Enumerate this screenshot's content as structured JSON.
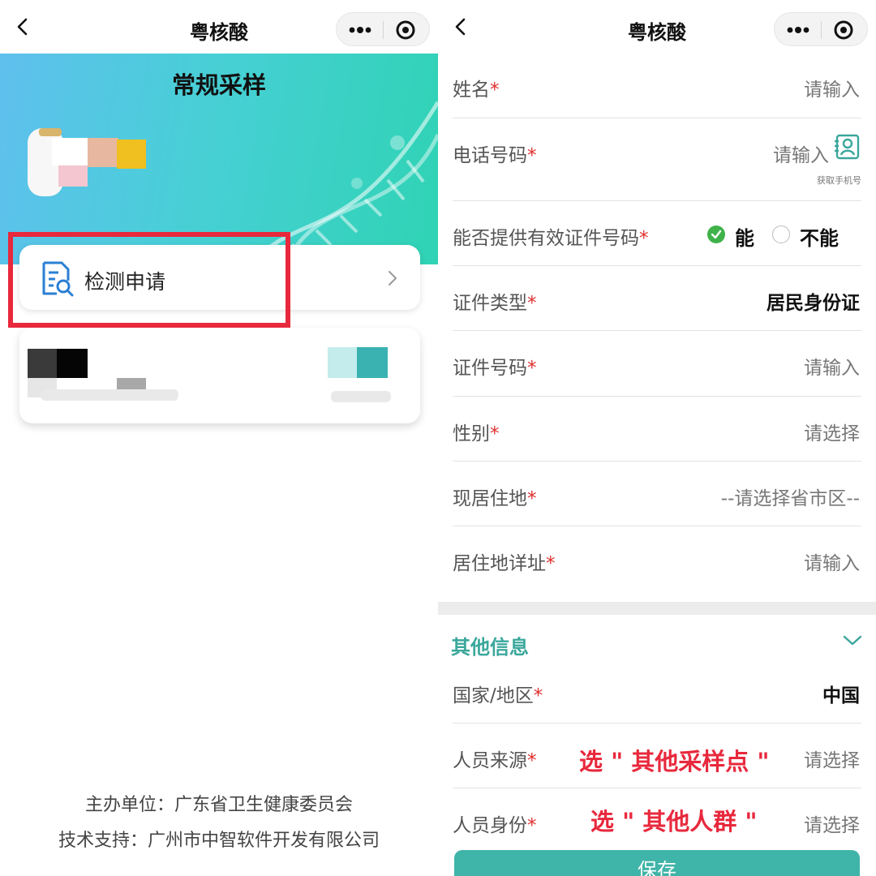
{
  "left": {
    "nav_title": "粤核酸",
    "hero_title": "常规采样",
    "apply_label": "检测申请",
    "footer_organizer": "主办单位：广东省卫生健康委员会",
    "footer_support": "技术支持：广州市中智软件开发有限公司",
    "colors": {
      "hero_start": "#5fc0ee",
      "hero_end": "#2fd3b4",
      "highlight": "#e8283c"
    }
  },
  "right": {
    "nav_title": "粤核酸",
    "fields": [
      {
        "label": "姓名",
        "required": "*",
        "value": "请输入"
      },
      {
        "label": "电话号码",
        "required": "*",
        "value": "请输入",
        "hint": "获取手机号"
      },
      {
        "label": "能否提供有效证件号码",
        "required": "*",
        "options": [
          "能",
          "不能"
        ],
        "selected": "能"
      },
      {
        "label": "证件类型",
        "required": "*",
        "value": "居民身份证"
      },
      {
        "label": "证件号码",
        "required": "*",
        "value": "请输入"
      },
      {
        "label": "性别",
        "required": "*",
        "value": "请选择"
      },
      {
        "label": "现居住地",
        "required": "*",
        "value": "--请选择省市区--"
      },
      {
        "label": "居住地详址",
        "required": "*",
        "value": "请输入"
      }
    ],
    "section_title": "其他信息",
    "other_fields": [
      {
        "label": "国家/地区",
        "required": "*",
        "value": "中国"
      },
      {
        "label": "人员来源",
        "required": "*",
        "value": "请选择",
        "annotation": "选 \" 其他采样点 \""
      },
      {
        "label": "人员身份",
        "required": "*",
        "value": "请选择",
        "annotation": "选 \" 其他人群 \""
      }
    ],
    "save_label": "保存",
    "colors": {
      "accent": "#3aa79c",
      "button": "#3fb4a8",
      "radio_on": "#3fb24a",
      "annotation": "#e8283c"
    }
  },
  "icons": [
    "back-icon",
    "more-icon",
    "target-icon",
    "document-search-icon",
    "chevron-right-icon",
    "contact-icon",
    "chevron-down-icon",
    "dna-icon"
  ]
}
